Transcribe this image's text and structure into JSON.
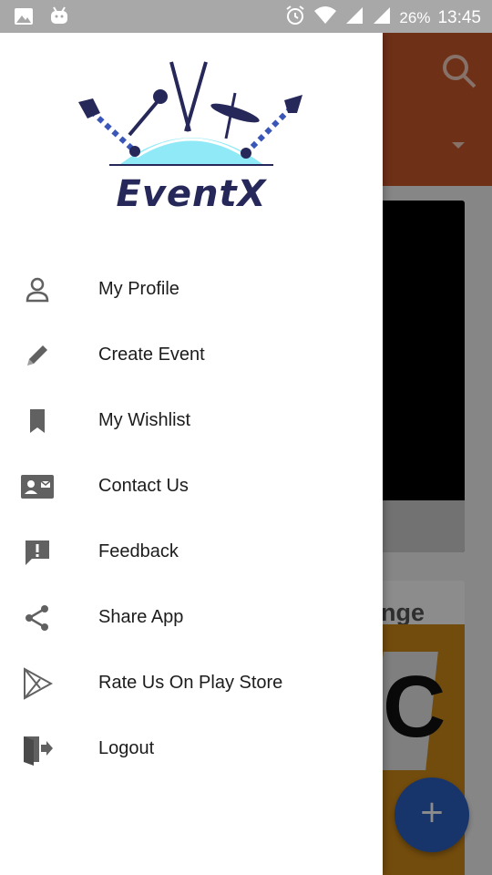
{
  "status_bar": {
    "battery_percent": "26%",
    "time": "13:45",
    "left_icons": [
      "image-icon",
      "android-icon"
    ],
    "right_icons": [
      "alarm-icon",
      "wifi-icon",
      "signal-icon",
      "signal-icon",
      "battery-icon"
    ]
  },
  "drawer": {
    "app_name": "EventX",
    "items": [
      {
        "label": "My Profile",
        "icon": "person-icon"
      },
      {
        "label": "Create Event",
        "icon": "pencil-icon"
      },
      {
        "label": "My Wishlist",
        "icon": "bookmark-icon"
      },
      {
        "label": "Contact Us",
        "icon": "contact-card-icon"
      },
      {
        "label": "Feedback",
        "icon": "feedback-icon"
      },
      {
        "label": "Share App",
        "icon": "share-icon"
      },
      {
        "label": "Rate Us On Play Store",
        "icon": "play-store-icon"
      },
      {
        "label": "Logout",
        "icon": "logout-icon"
      }
    ]
  },
  "background": {
    "card_title_fragment": "nge",
    "card_image_letter": "C",
    "fab_symbol": "+"
  },
  "colors": {
    "toolbar": "#c9582a",
    "logo_text": "#27285a",
    "fab": "#2b62c4",
    "icon_gray": "#616161"
  }
}
